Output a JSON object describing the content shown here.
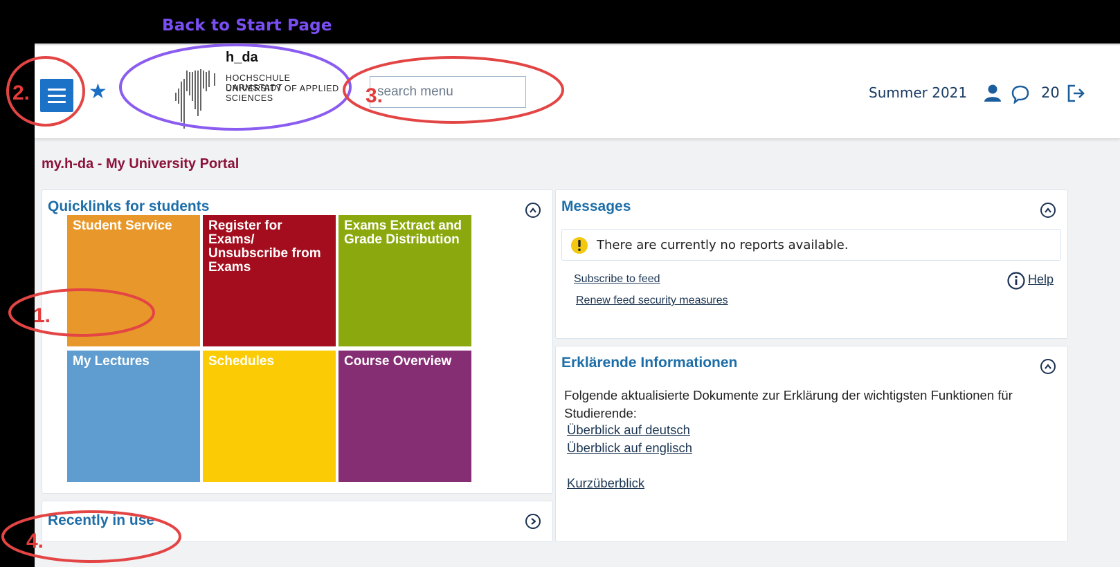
{
  "annotation": {
    "back_label": "Back to Start Page",
    "numbers": [
      "1.",
      "2.",
      "3.",
      "4."
    ]
  },
  "header": {
    "logo": {
      "brand": "h_da",
      "line1": "HOCHSCHULE DARMSTADT",
      "line2": "UNIVERSITY OF APPLIED SCIENCES"
    },
    "search_placeholder": "search menu",
    "semester": "Summer 2021",
    "message_count": "20",
    "icons": [
      "menu-icon",
      "star-icon",
      "user-icon",
      "chat-icon",
      "logout-icon"
    ]
  },
  "page_title": "my.h-da - My University Portal",
  "quicklinks": {
    "title": "Quicklinks for students",
    "tiles": [
      {
        "label": "Student Service",
        "color": "#e8982a"
      },
      {
        "label": "Register for Exams/ Unsubscribe from Exams",
        "color": "#a30d1d"
      },
      {
        "label": "Exams Extract and Grade Distribution",
        "color": "#8ba90e"
      },
      {
        "label": "My Lectures",
        "color": "#5f9ccf"
      },
      {
        "label": "Schedules",
        "color": "#fbcc06"
      },
      {
        "label": "Course Overview",
        "color": "#862e73"
      }
    ]
  },
  "recent": {
    "title": "Recently in use"
  },
  "messages": {
    "title": "Messages",
    "no_reports": "There are currently no reports available.",
    "subscribe": "Subscribe to feed",
    "renew": "Renew feed security measures",
    "help": "Help"
  },
  "info": {
    "title": "Erklärende Informationen",
    "body": "Folgende aktualisierte Dokumente zur Erklärung der wichtigsten Funktionen für Studierende:",
    "links": [
      "Überblick auf deutsch",
      "Überblick auf englisch",
      "Kurzüberblick"
    ]
  },
  "colors": {
    "accent": "#1c72c7",
    "title": "#8b1239",
    "annotation_red": "#e43b3b",
    "annotation_purple": "#7a4ef5"
  }
}
